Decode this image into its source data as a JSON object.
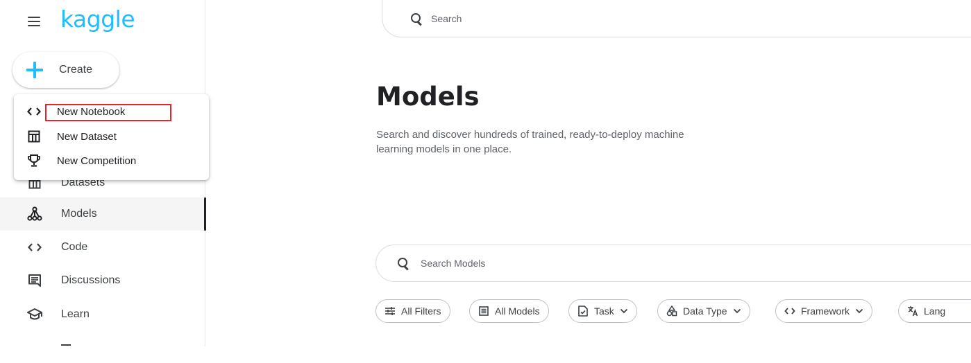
{
  "header": {
    "logo_text": "kaggle",
    "search_placeholder": "Search"
  },
  "sidebar": {
    "create_label": "Create",
    "items": [
      {
        "label": "Datasets",
        "icon": "table-icon"
      },
      {
        "label": "Models",
        "icon": "models-icon",
        "active": true
      },
      {
        "label": "Code",
        "icon": "code-icon"
      },
      {
        "label": "Discussions",
        "icon": "discussions-icon"
      },
      {
        "label": "Learn",
        "icon": "learn-icon"
      }
    ]
  },
  "create_menu": {
    "items": [
      {
        "label": "New Notebook",
        "icon": "code-icon",
        "highlighted": true
      },
      {
        "label": "New Dataset",
        "icon": "table-icon"
      },
      {
        "label": "New Competition",
        "icon": "trophy-icon"
      }
    ]
  },
  "main": {
    "title": "Models",
    "description": "Search and discover hundreds of trained, ready-to-deploy machine learning models in one place.",
    "search_placeholder": "Search Models",
    "filters": [
      {
        "label": "All Filters",
        "icon": "filters-icon"
      },
      {
        "label": "All Models",
        "icon": "list-icon"
      },
      {
        "label": "Task",
        "icon": "task-icon",
        "dropdown": true
      },
      {
        "label": "Data Type",
        "icon": "data-type-icon",
        "dropdown": true
      },
      {
        "label": "Framework",
        "icon": "code-icon",
        "dropdown": true
      },
      {
        "label": "Lang",
        "icon": "translate-icon"
      }
    ]
  },
  "colors": {
    "brand": "#20beff",
    "highlight": "#e5242c",
    "text": "#202124"
  }
}
